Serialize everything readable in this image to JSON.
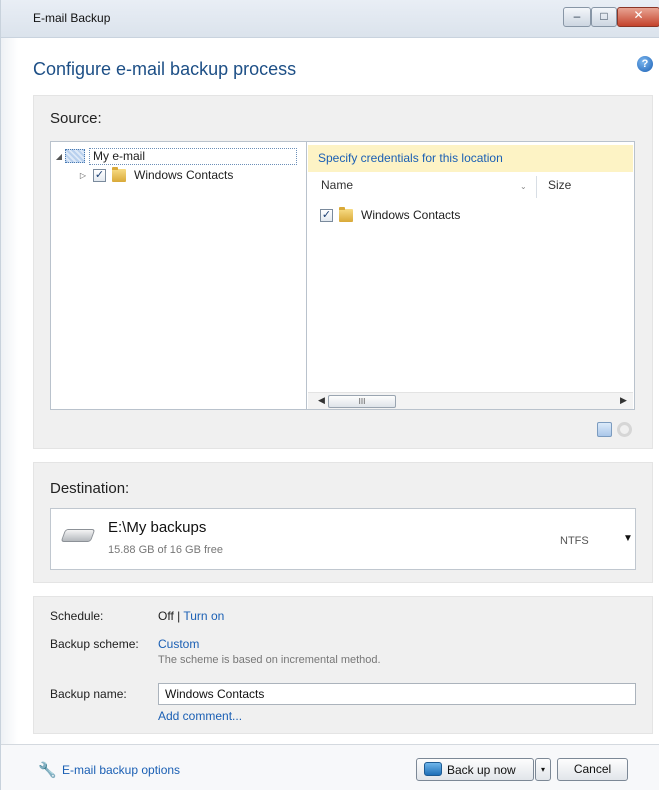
{
  "window": {
    "title": "E-mail Backup",
    "minimize_glyph": "–",
    "maximize_glyph": "□",
    "close_glyph": "✕"
  },
  "heading": "Configure e-mail backup process",
  "help_glyph": "?",
  "source": {
    "label": "Source:",
    "tree": {
      "root_label": "My e-mail",
      "root_expander": "◢",
      "child_expander": "▷",
      "child_label": "Windows Contacts",
      "child_checked": "✓"
    },
    "list": {
      "credentials_link": "Specify credentials for this location",
      "columns": [
        "Name",
        "Size"
      ],
      "sort_glyph": "⌄",
      "items": [
        {
          "name": "Windows Contacts",
          "checked": "✓"
        }
      ],
      "scroll_left": "◀",
      "scroll_right": "▶",
      "scroll_thumb": "III"
    }
  },
  "destination": {
    "label": "Destination:",
    "path": "E:\\My backups",
    "free": "15.88 GB of 16 GB free",
    "fs": "NTFS",
    "arrow": "▼"
  },
  "settings": {
    "schedule_label": "Schedule:",
    "schedule_value": "Off",
    "schedule_sep": " | ",
    "schedule_link": "Turn on",
    "scheme_label": "Backup scheme:",
    "scheme_value": "Custom",
    "scheme_desc": "The scheme is based on incremental method.",
    "name_label": "Backup name:",
    "name_value": "Windows Contacts",
    "add_comment": "Add comment..."
  },
  "footer": {
    "options_link": "E-mail backup options",
    "wrench_glyph": "🔧",
    "backup_button": "Back up now",
    "split_glyph": "▾",
    "cancel_button": "Cancel"
  },
  "colors": {
    "link": "#1a5fb4",
    "heading": "#1d4f86",
    "credentials_bar": "#fdf3c5",
    "panel_bg": "#f0f0f0"
  }
}
